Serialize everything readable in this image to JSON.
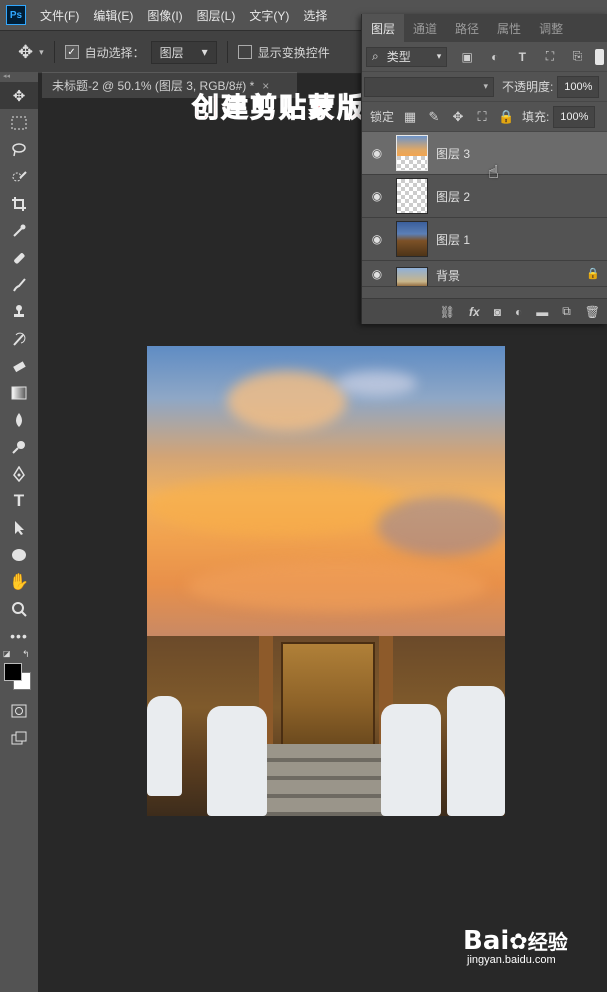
{
  "app": {
    "logo": "Ps",
    "menu": [
      "文件(F)",
      "编辑(E)",
      "图像(I)",
      "图层(L)",
      "文字(Y)",
      "选择"
    ]
  },
  "options_bar": {
    "auto_select_label": "自动选择：",
    "auto_select_checked": true,
    "auto_select_target": "图层",
    "show_transform_label": "显示变换控件",
    "show_transform_checked": false
  },
  "document_tab": {
    "title": "未标题-2 @ 50.1% (图层 3, RGB/8#) *",
    "close": "×"
  },
  "annotation": "创建剪贴蒙版",
  "layers_panel": {
    "tabs": [
      "图层",
      "通道",
      "路径",
      "属性",
      "调整"
    ],
    "active_tab": "图层",
    "filter_label": "类型",
    "opacity_label": "不透明度:",
    "opacity_value": "100%",
    "lock_label": "锁定:",
    "fill_label": "填充:",
    "fill_value": "100%",
    "layers": [
      {
        "name": "图层 3",
        "selected": true,
        "thumb": "sky"
      },
      {
        "name": "图层 2",
        "selected": false,
        "thumb": "transparent"
      },
      {
        "name": "图层 1",
        "selected": false,
        "thumb": "temple"
      },
      {
        "name": "背景",
        "selected": false,
        "thumb": "temple",
        "locked": true
      }
    ]
  },
  "watermark": {
    "brand": "Bai",
    "brand2": "经验",
    "url": "jingyan.baidu.com"
  }
}
